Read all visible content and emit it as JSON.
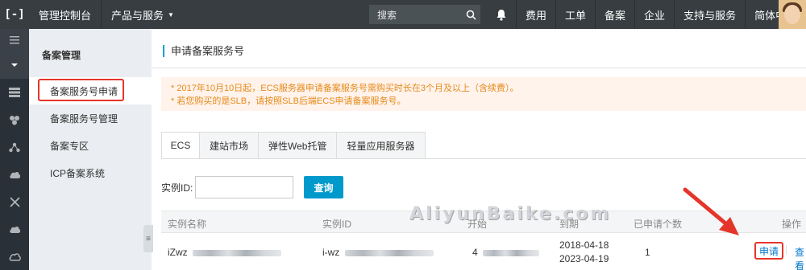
{
  "topbar": {
    "logo": "[-]",
    "console": "管理控制台",
    "products": "产品与服务",
    "search_placeholder": "搜索",
    "nav": [
      "费用",
      "工单",
      "备案",
      "企业",
      "支持与服务",
      "简体中文"
    ]
  },
  "sidemenu": {
    "title": "备案管理",
    "items": [
      {
        "label": "备案服务号申请"
      },
      {
        "label": "备案服务号管理"
      },
      {
        "label": "备案专区"
      },
      {
        "label": "ICP备案系统"
      }
    ]
  },
  "main": {
    "title": "申请备案服务号",
    "notices": [
      "* 2017年10月10日起，ECS服务器申请备案服务号需购买时长在3个月及以上（含续费）。",
      "* 若您购买的是SLB，请按照SLB后端ECS申请备案服务号。"
    ],
    "tabs": [
      "ECS",
      "建站市场",
      "弹性Web托管",
      "轻量应用服务器"
    ],
    "search": {
      "label": "实例ID:",
      "value": "",
      "button": "查询"
    },
    "table": {
      "headers": [
        "实例名称",
        "实例ID",
        "开始",
        "到期",
        "已申请个数",
        "操作"
      ],
      "rows": [
        {
          "name": "iZwz",
          "id": "i-wz",
          "start_prefix": "4",
          "date_start": "2018-04-18",
          "date_end": "2023-04-19",
          "count": "1",
          "action_apply": "申请",
          "action_view": "查看"
        }
      ]
    },
    "watermark": "AliyunBaike.com"
  }
}
